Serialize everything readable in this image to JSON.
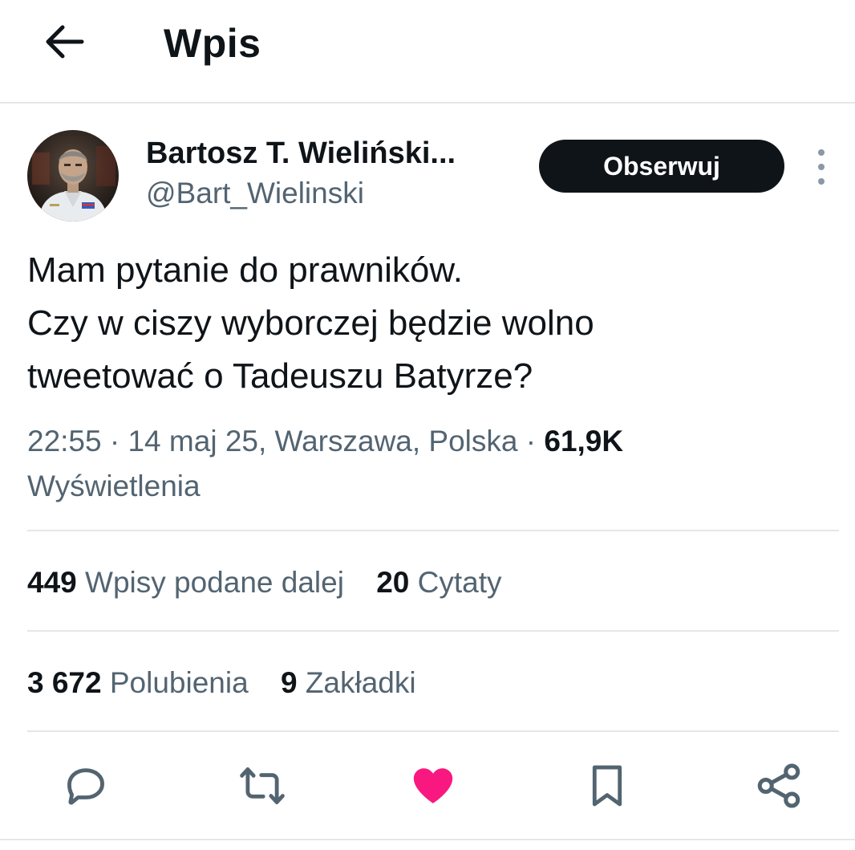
{
  "header": {
    "title": "Wpis",
    "back_icon": "arrow-left-icon"
  },
  "author": {
    "name": "Bartosz T. Wieliński...",
    "handle": "@Bart_Wielinski",
    "avatar_description": "profile-photo"
  },
  "follow_button": {
    "label": "Obserwuj"
  },
  "more_icon": "more-vertical-icon",
  "tweet": {
    "lines": [
      "Mam pytanie do prawników.",
      "Czy w ciszy wyborczej będzie wolno",
      "tweetować o Tadeuszu Batyrze?"
    ]
  },
  "meta": {
    "time": "22:55",
    "separator": " · ",
    "date": "14 maj 25",
    "location": ", Warszawa, Polska",
    "views_count": "61,9K",
    "views_label": "Wyświetlenia"
  },
  "stats": {
    "reposts": {
      "count": "449",
      "label": "Wpisy podane dalej"
    },
    "quotes": {
      "count": "20",
      "label": "Cytaty"
    },
    "likes": {
      "count": "3 672",
      "label": "Polubienia"
    },
    "bookmarks": {
      "count": "9",
      "label": "Zakładki"
    }
  },
  "actions": {
    "reply": "reply-icon",
    "repost": "repost-icon",
    "like": "heart-icon",
    "bookmark": "bookmark-icon",
    "share": "share-icon",
    "like_color": "#f91880"
  },
  "colors": {
    "text": "#0f1419",
    "secondary": "#536471",
    "divider": "#e4e7ea",
    "button_bg": "#0f1419"
  }
}
